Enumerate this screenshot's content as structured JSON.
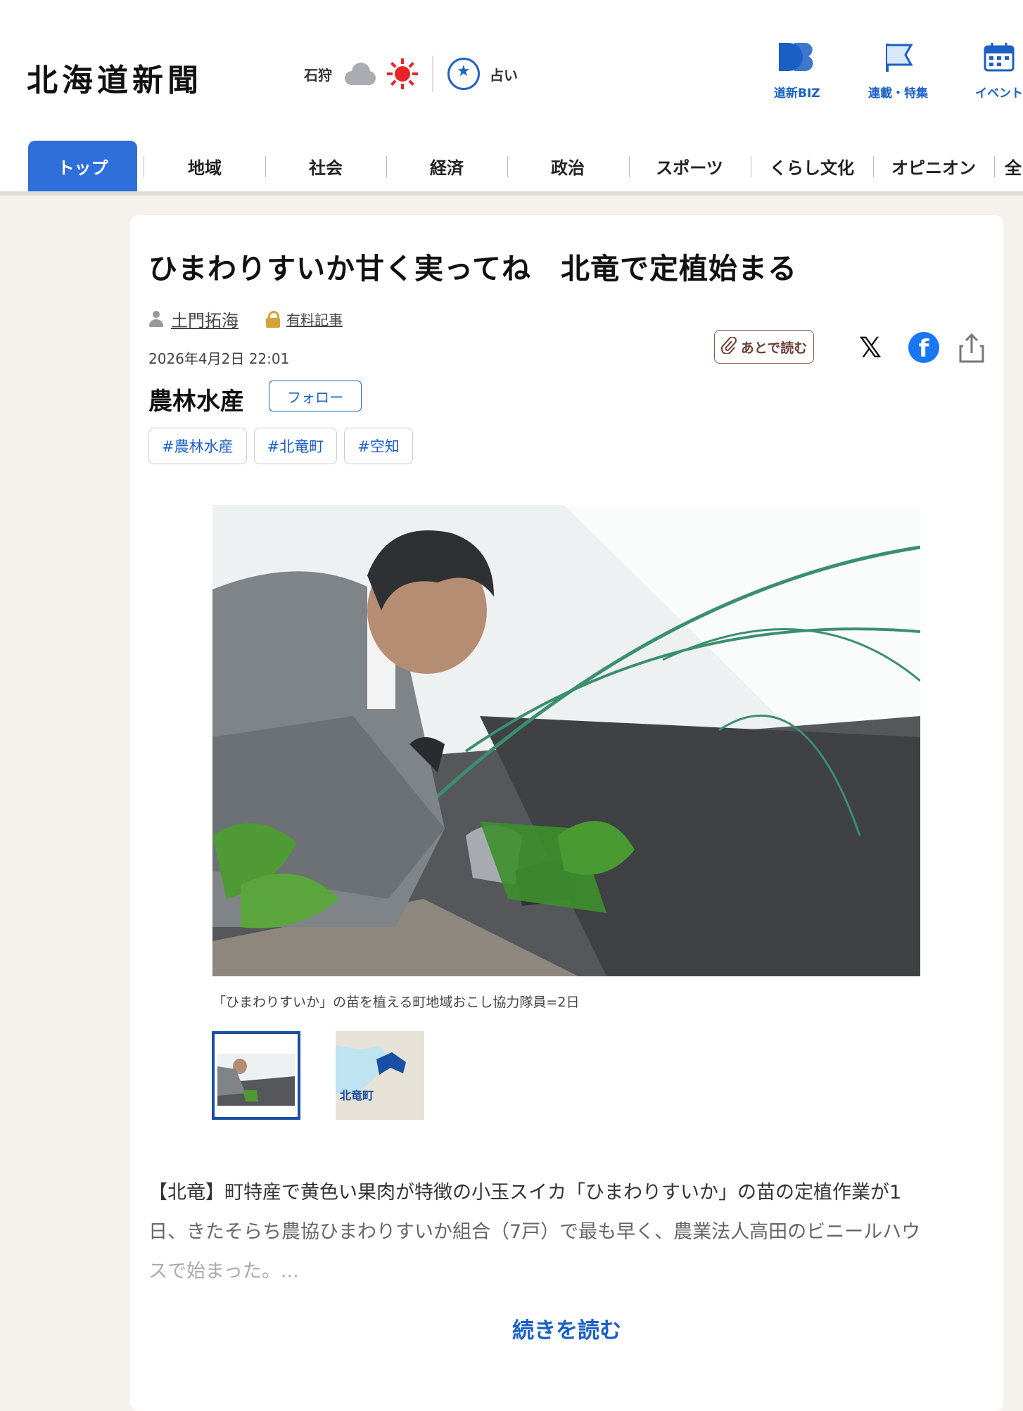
{
  "header": {
    "logo": "北海道新聞",
    "weather_location": "石狩",
    "fortune_label": "占い",
    "nav": [
      {
        "label": "道新BIZ",
        "icon": "db-logo-icon"
      },
      {
        "label": "連載・特集",
        "icon": "flag-icon"
      },
      {
        "label": "イベント",
        "icon": "calendar-icon"
      }
    ]
  },
  "tabs": [
    "トップ",
    "地域",
    "社会",
    "経済",
    "政治",
    "スポーツ",
    "くらし文化",
    "オピニオン",
    "全"
  ],
  "article": {
    "title": "ひまわりすいか甘く実ってね　北竜で定植始まる",
    "author": "土門拓海",
    "paid_label": "有料記事",
    "date": "2026年4月2日 22:01",
    "save_later": "あとで読む",
    "category": "農林水産",
    "follow": "フォロー",
    "tags": [
      "#農林水産",
      "#北竜町",
      "#空知"
    ],
    "caption": "「ひまわりすいか」の苗を植える町地域おこし協力隊員=2日",
    "map_label": "北竜町",
    "body_line1": "【北竜】町特産で黄色い果肉が特徴の小玉スイカ「ひまわりすいか」の苗の定植作業が1",
    "body_line2": "日、きたそらち農協ひまわりすいか組合（7戸）で最も早く、農業法人高田のビニールハウ",
    "body_line3": "スで始まった。...",
    "read_more": "続きを読む"
  },
  "colors": {
    "accent": "#2f6fda",
    "link": "#1a5fc4",
    "weather_sun": "#e6242a"
  }
}
